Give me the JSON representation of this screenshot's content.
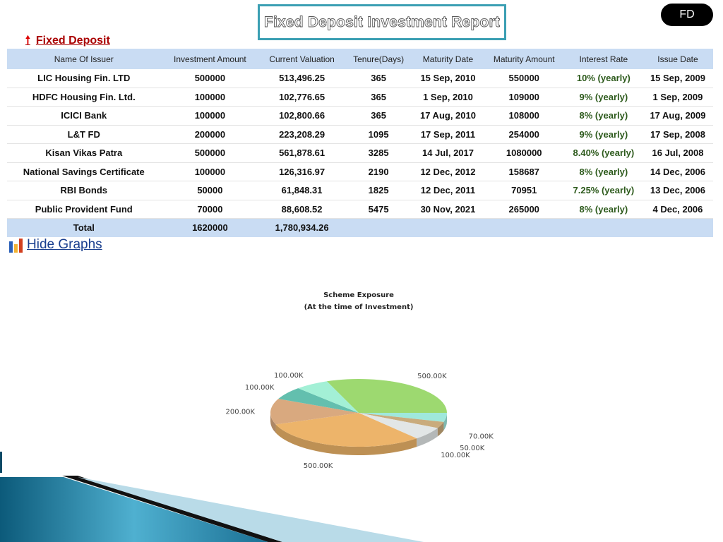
{
  "header": {
    "title": "Fixed Deposit Investment Report",
    "badge": "FD",
    "section_link": "Fixed Deposit",
    "hide_graphs": "Hide Graphs"
  },
  "table": {
    "columns": [
      "Name Of Issuer",
      "Investment Amount",
      "Current Valuation",
      "Tenure(Days)",
      "Maturity Date",
      "Maturity Amount",
      "Interest Rate",
      "Issue Date"
    ],
    "rows": [
      [
        "LIC Housing Fin. LTD",
        "500000",
        "513,496.25",
        "365",
        "15 Sep, 2010",
        "550000",
        "10% (yearly)",
        "15 Sep, 2009"
      ],
      [
        "HDFC Housing Fin. Ltd.",
        "100000",
        "102,776.65",
        "365",
        "1 Sep, 2010",
        "109000",
        "9% (yearly)",
        "1 Sep, 2009"
      ],
      [
        "ICICI Bank",
        "100000",
        "102,800.66",
        "365",
        "17 Aug, 2010",
        "108000",
        "8% (yearly)",
        "17 Aug, 2009"
      ],
      [
        "L&T FD",
        "200000",
        "223,208.29",
        "1095",
        "17 Sep, 2011",
        "254000",
        "9% (yearly)",
        "17 Sep, 2008"
      ],
      [
        "Kisan Vikas Patra",
        "500000",
        "561,878.61",
        "3285",
        "14 Jul, 2017",
        "1080000",
        "8.40% (yearly)",
        "16 Jul, 2008"
      ],
      [
        "National Savings Certificate",
        "100000",
        "126,316.97",
        "2190",
        "12 Dec, 2012",
        "158687",
        "8% (yearly)",
        "14 Dec, 2006"
      ],
      [
        "RBI Bonds",
        "50000",
        "61,848.31",
        "1825",
        "12 Dec, 2011",
        "70951",
        "7.25% (yearly)",
        "13 Dec, 2006"
      ],
      [
        "Public Provident Fund",
        "70000",
        "88,608.52",
        "5475",
        "30 Nov, 2021",
        "265000",
        "8% (yearly)",
        "4 Dec, 2006"
      ]
    ],
    "total": {
      "label": "Total",
      "investment": "1620000",
      "valuation": "1,780,934.26"
    }
  },
  "chart_data": {
    "type": "pie",
    "title": "Scheme Exposure",
    "subtitle": "(At the time of Investment)",
    "slices": [
      {
        "label": "70.00K",
        "value": 70000,
        "color": "#9fe8dc"
      },
      {
        "label": "50.00K",
        "value": 50000,
        "color": "#c9ab7c"
      },
      {
        "label": "100.00K",
        "value": 100000,
        "color": "#e2e6e6"
      },
      {
        "label": "500.00K",
        "value": 500000,
        "color": "#edb46a"
      },
      {
        "label": "200.00K",
        "value": 200000,
        "color": "#d9a97f"
      },
      {
        "label": "100.00K",
        "value": 100000,
        "color": "#63bfae"
      },
      {
        "label": "100.00K",
        "value": 100000,
        "color": "#a3f0d6"
      },
      {
        "label": "500.00K",
        "value": 500000,
        "color": "#9dd970"
      }
    ]
  }
}
